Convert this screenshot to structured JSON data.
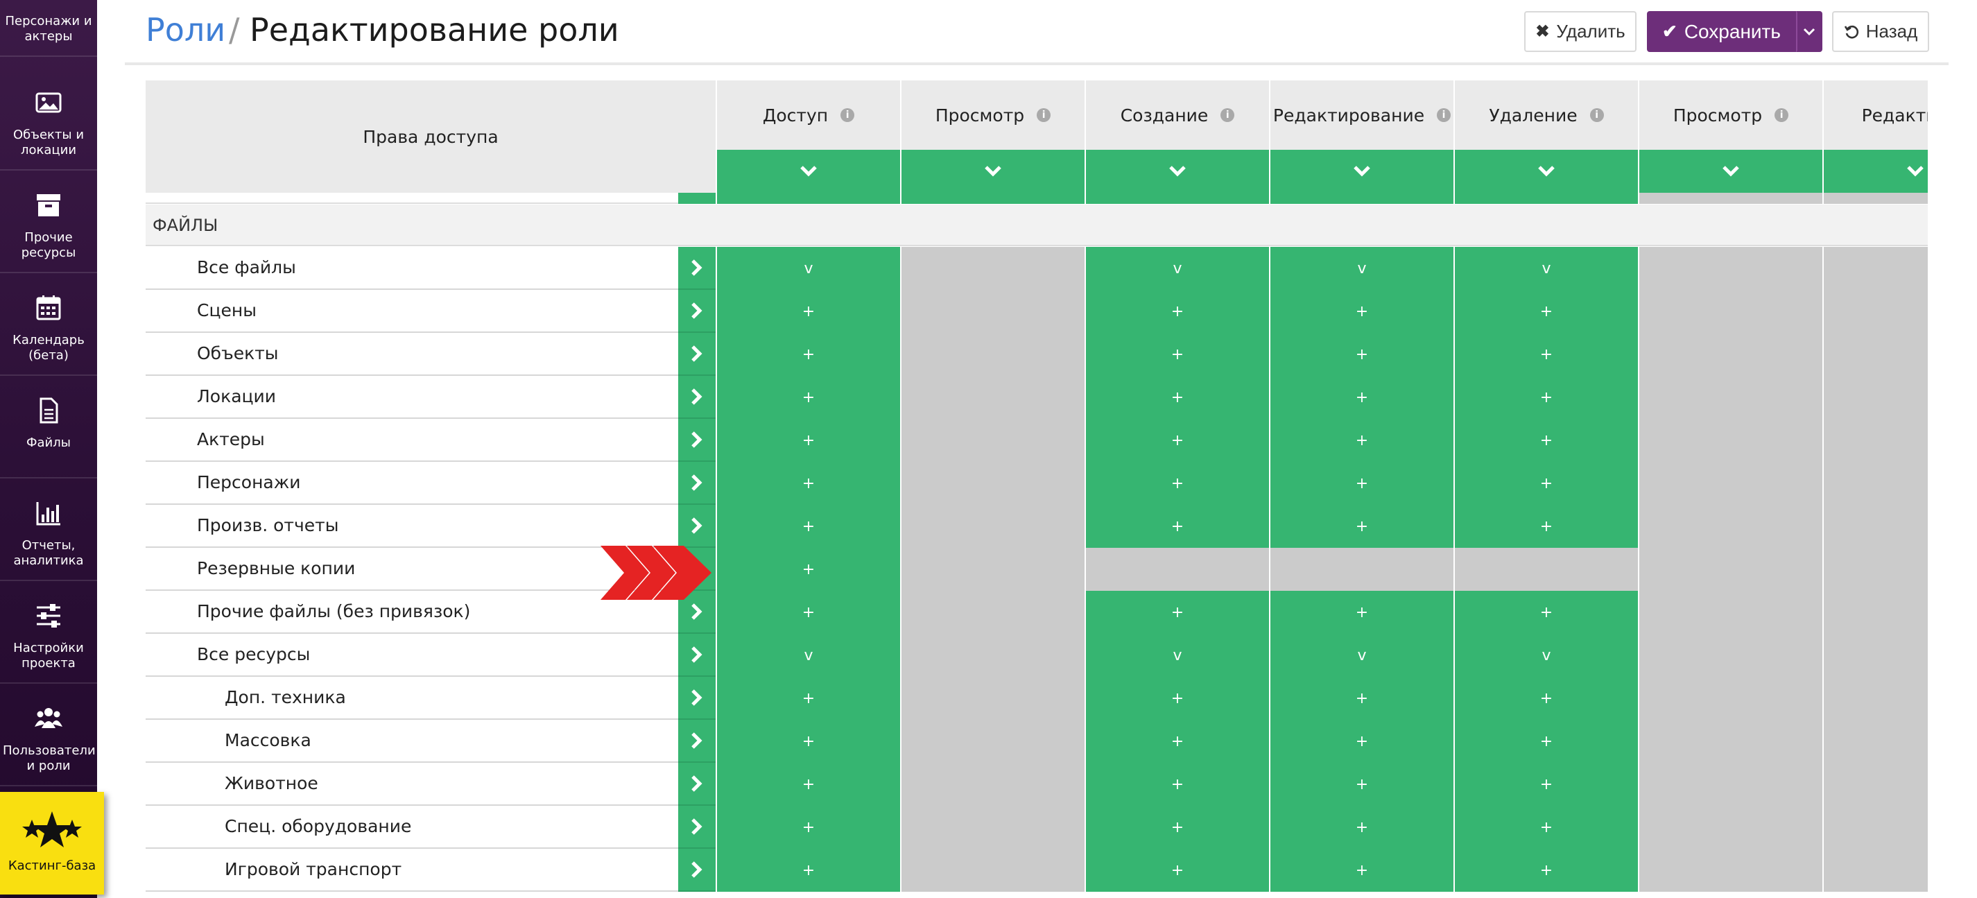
{
  "colors": {
    "sidebar": "#3c1a47",
    "accent_green": "#36b571",
    "disabled_grey": "#cbcbcb",
    "save_purple": "#6d2e7a",
    "link_blue": "#3f7fd6",
    "casting_yellow": "#f9df10"
  },
  "sidebar": {
    "items": [
      {
        "label": "Персонажи и актеры",
        "icon": "person-icon"
      },
      {
        "label": "Объекты и локации",
        "icon": "image-icon"
      },
      {
        "label": "Прочие ресурсы",
        "icon": "archive-box-icon"
      },
      {
        "label": "Календарь (бета)",
        "icon": "calendar-icon"
      },
      {
        "label": "Файлы",
        "icon": "file-icon"
      },
      {
        "label": "Отчеты, аналитика",
        "icon": "bar-chart-icon"
      },
      {
        "label": "Настройки проекта",
        "icon": "sliders-icon"
      },
      {
        "label": "Пользователи и роли",
        "icon": "users-icon"
      },
      {
        "label": "Кастинг-база",
        "icon": "stars-icon"
      }
    ]
  },
  "header": {
    "breadcrumb_root": "Роли",
    "separator": "/",
    "title": "Редактирование роли",
    "delete_label": "Удалить",
    "save_label": "Сохранить",
    "back_label": "Назад"
  },
  "table": {
    "left_header": "Права доступа",
    "columns": [
      "Доступ",
      "Просмотр",
      "Создание",
      "Редактирование",
      "Удаление",
      "Просмотр",
      "Редактиров"
    ],
    "section": "ФАЙЛЫ",
    "rows": [
      {
        "name": "Все файлы",
        "indent": 1,
        "cells": [
          "v",
          "",
          "v",
          "v",
          "v",
          "",
          ""
        ]
      },
      {
        "name": "Сцены",
        "indent": 1,
        "cells": [
          "+",
          "",
          "+",
          "+",
          "+",
          "",
          ""
        ]
      },
      {
        "name": "Объекты",
        "indent": 1,
        "cells": [
          "+",
          "",
          "+",
          "+",
          "+",
          "",
          ""
        ]
      },
      {
        "name": "Локации",
        "indent": 1,
        "cells": [
          "+",
          "",
          "+",
          "+",
          "+",
          "",
          ""
        ]
      },
      {
        "name": "Актеры",
        "indent": 1,
        "cells": [
          "+",
          "",
          "+",
          "+",
          "+",
          "",
          ""
        ]
      },
      {
        "name": "Персонажи",
        "indent": 1,
        "cells": [
          "+",
          "",
          "+",
          "+",
          "+",
          "",
          ""
        ]
      },
      {
        "name": "Произв. отчеты",
        "indent": 1,
        "cells": [
          "+",
          "",
          "+",
          "+",
          "+",
          "",
          ""
        ]
      },
      {
        "name": "Резервные копии",
        "indent": 1,
        "cells": [
          "+",
          "",
          "",
          "",
          "",
          "",
          ""
        ],
        "highlighted": true
      },
      {
        "name": "Прочие файлы (без привязок)",
        "indent": 1,
        "cells": [
          "+",
          "",
          "+",
          "+",
          "+",
          "",
          ""
        ]
      },
      {
        "name": "Все ресурсы",
        "indent": 1,
        "cells": [
          "v",
          "",
          "v",
          "v",
          "v",
          "",
          ""
        ]
      },
      {
        "name": "Доп. техника",
        "indent": 2,
        "cells": [
          "+",
          "",
          "+",
          "+",
          "+",
          "",
          ""
        ]
      },
      {
        "name": "Массовка",
        "indent": 2,
        "cells": [
          "+",
          "",
          "+",
          "+",
          "+",
          "",
          ""
        ]
      },
      {
        "name": "Животное",
        "indent": 2,
        "cells": [
          "+",
          "",
          "+",
          "+",
          "+",
          "",
          ""
        ]
      },
      {
        "name": "Спец. оборудование",
        "indent": 2,
        "cells": [
          "+",
          "",
          "+",
          "+",
          "+",
          "",
          ""
        ]
      },
      {
        "name": "Игровой транспорт",
        "indent": 2,
        "cells": [
          "+",
          "",
          "+",
          "+",
          "+",
          "",
          ""
        ]
      }
    ]
  }
}
